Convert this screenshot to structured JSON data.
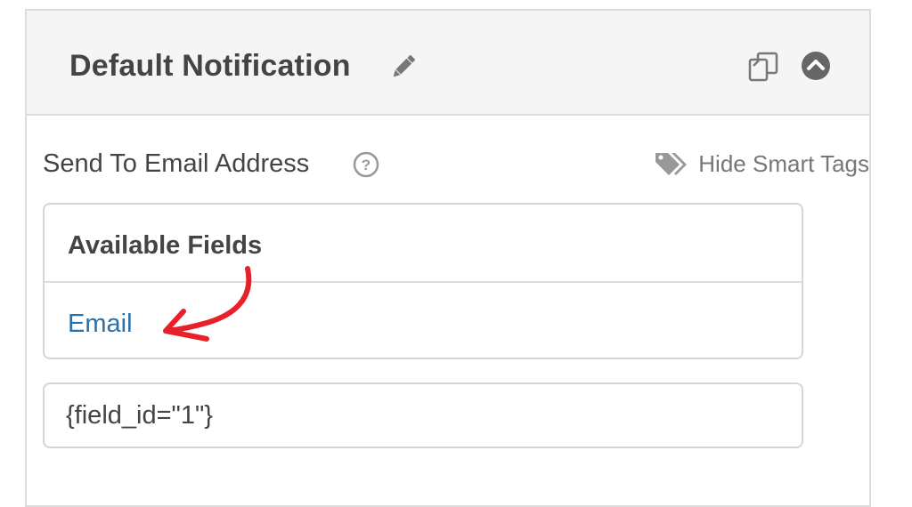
{
  "notification": {
    "title": "Default Notification",
    "edit_icon": "pencil-icon",
    "clone_icon": "clone-icon",
    "collapse_icon": "chevron-up-circle-icon"
  },
  "send_to": {
    "label": "Send To Email Address",
    "help_icon": "question-circle-icon",
    "smart_tags_toggle": "Hide Smart Tags",
    "smart_tags_icon": "tags-icon",
    "value": "{field_id=\"1\"}"
  },
  "available_fields": {
    "title": "Available Fields",
    "items": [
      {
        "label": "Email"
      }
    ]
  },
  "colors": {
    "header_bg": "#f5f5f5",
    "text": "#444444",
    "link": "#2b6fa8",
    "muted": "#777777",
    "border": "#dcdcdc",
    "annotation": "#e8202a"
  }
}
